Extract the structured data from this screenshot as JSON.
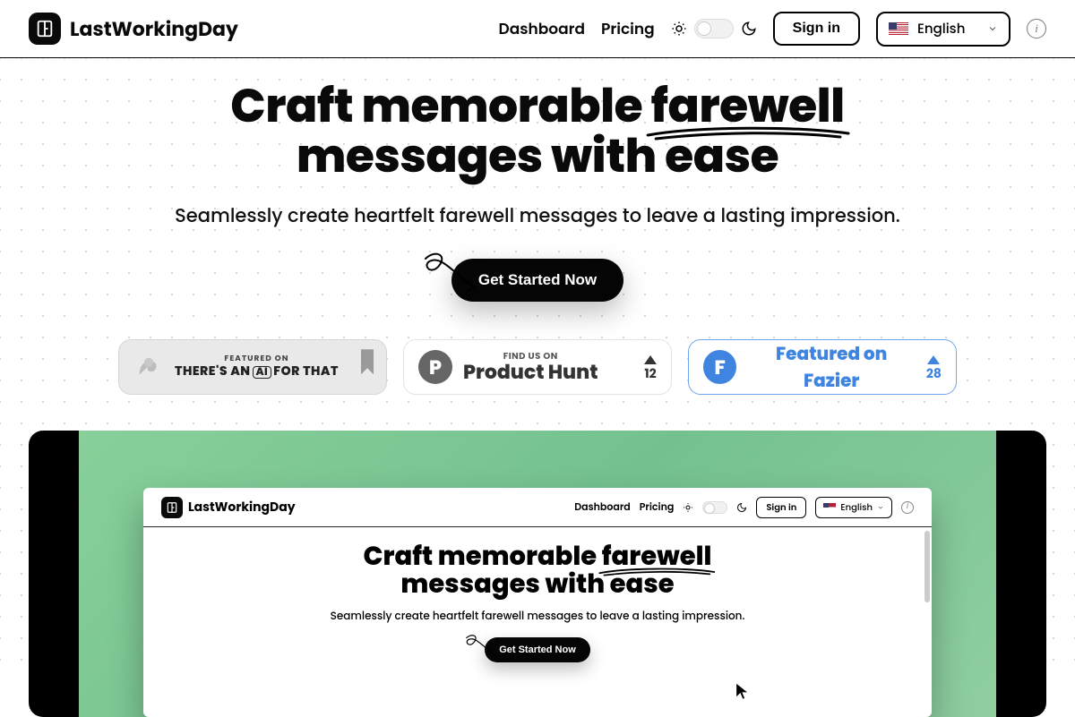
{
  "brand": {
    "name": "LastWorkingDay"
  },
  "nav": {
    "dashboard": "Dashboard",
    "pricing": "Pricing",
    "signin": "Sign in",
    "language": "English"
  },
  "hero": {
    "title_pre": "Craft memorable ",
    "title_underlined": "farewell",
    "title_post": " messages with ease",
    "subtitle": "Seamlessly create heartfelt farewell messages to leave a lasting impression.",
    "cta": "Get Started Now"
  },
  "badges": {
    "taaft": {
      "line1": "FEATURED ON",
      "line2_pre": "THERE'S AN",
      "line2_mid": "AI",
      "line2_post": "FOR THAT"
    },
    "producthunt": {
      "line1": "FIND US ON",
      "line2": "Product Hunt",
      "count": "12",
      "letter": "P"
    },
    "fazier": {
      "text": "Featured on Fazier",
      "count": "28",
      "letter": "F"
    }
  },
  "preview": {
    "brand": "LastWorkingDay",
    "nav": {
      "dashboard": "Dashboard",
      "pricing": "Pricing",
      "signin": "Sign in",
      "language": "English"
    },
    "hero": {
      "title_pre": "Craft memorable ",
      "title_underlined": "farewell",
      "title_post": " messages with ease",
      "subtitle": "Seamlessly create heartfelt farewell messages to leave a lasting impression.",
      "cta": "Get Started Now"
    }
  }
}
